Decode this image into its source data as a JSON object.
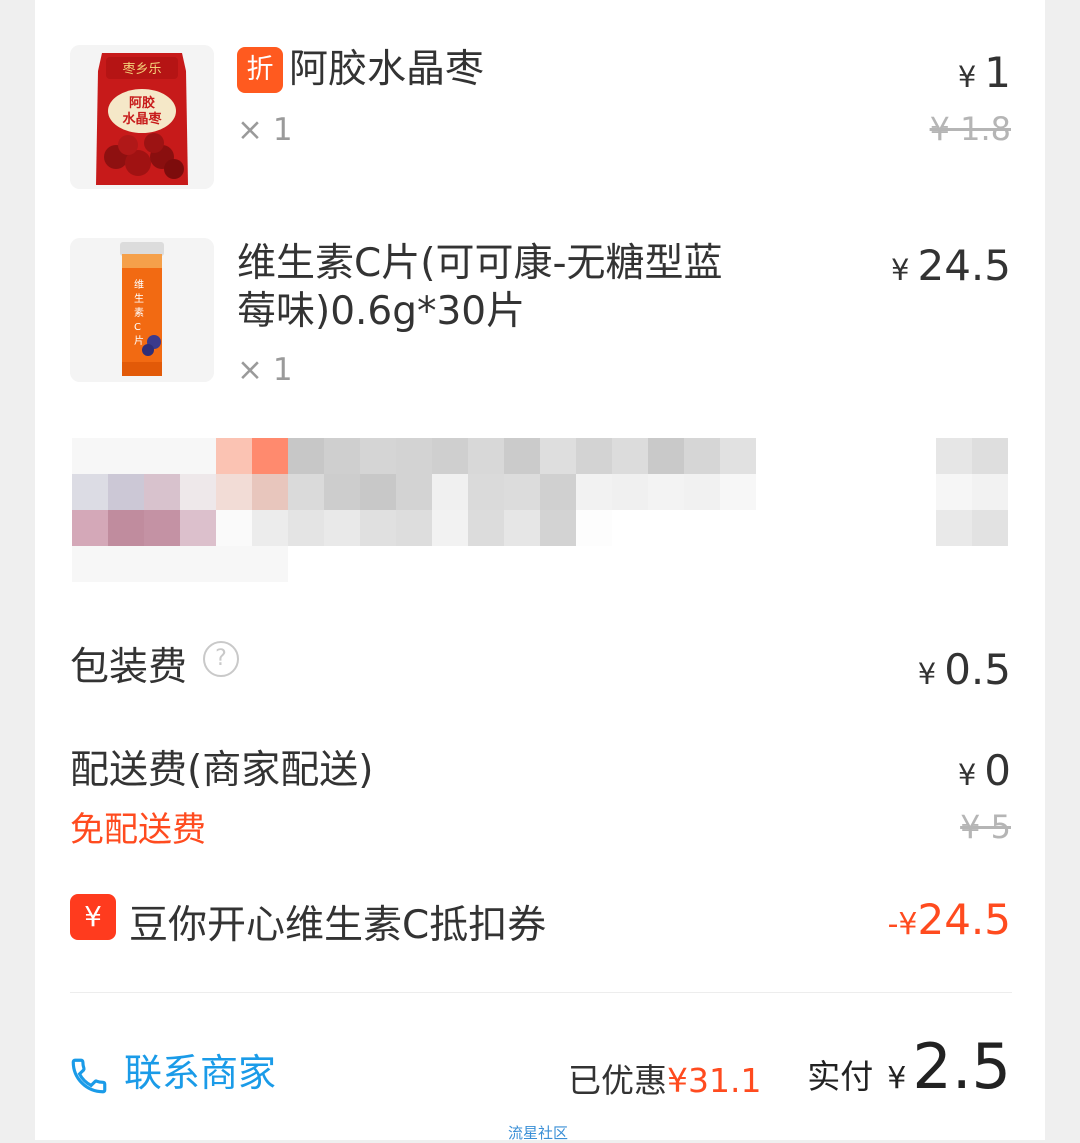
{
  "items": [
    {
      "tag": "折",
      "name": "阿胶水晶枣",
      "qty": "× 1",
      "price_symbol": "¥",
      "price": "1",
      "original_price": "¥ 1.8",
      "thumb_brand": "枣乡乐",
      "thumb_label": "阿胶\n水晶枣"
    },
    {
      "name": "维生素C片(可可康-无糖型蓝莓味)0.6g*30片",
      "qty": "× 1",
      "price_symbol": "¥",
      "price": "24.5",
      "thumb_label": "维生素C片"
    }
  ],
  "fees": {
    "packaging_label": "包装费",
    "packaging_symbol": "¥",
    "packaging_value": "0.5",
    "delivery_label": "配送费(商家配送)",
    "delivery_note": "免配送费",
    "delivery_symbol": "¥",
    "delivery_value": "0",
    "delivery_original": "¥ 5"
  },
  "coupon": {
    "icon_text": "¥",
    "label": "豆你开心维生素C抵扣券",
    "sign": "-¥",
    "value": "24.5"
  },
  "footer": {
    "contact_label": "联系商家",
    "saved_label": "已优惠",
    "saved_amount": "¥31.1",
    "paid_label": "实付",
    "paid_symbol": "¥",
    "paid_value": "2.5"
  },
  "watermark": "流星社区",
  "colors": {
    "accent": "#ff4b1f",
    "link": "#1a9be8",
    "text": "#333333",
    "muted": "#9a9a9a"
  }
}
